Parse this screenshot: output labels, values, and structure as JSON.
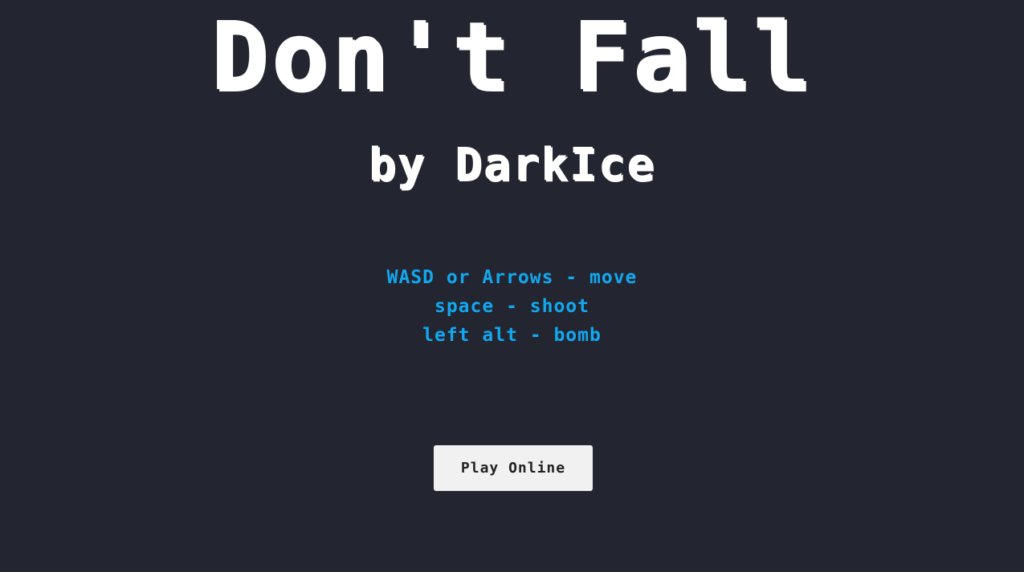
{
  "title": "Don't Fall",
  "subtitle": "by DarkIce",
  "controls": [
    "WASD or Arrows - move",
    "space - shoot",
    "left alt - bomb"
  ],
  "play_button_label": "Play Online",
  "colors": {
    "background": "#232530",
    "title": "#ffffff",
    "controls_text": "#12a8f0",
    "button_bg": "#f1f1f1",
    "button_text": "#222222"
  }
}
